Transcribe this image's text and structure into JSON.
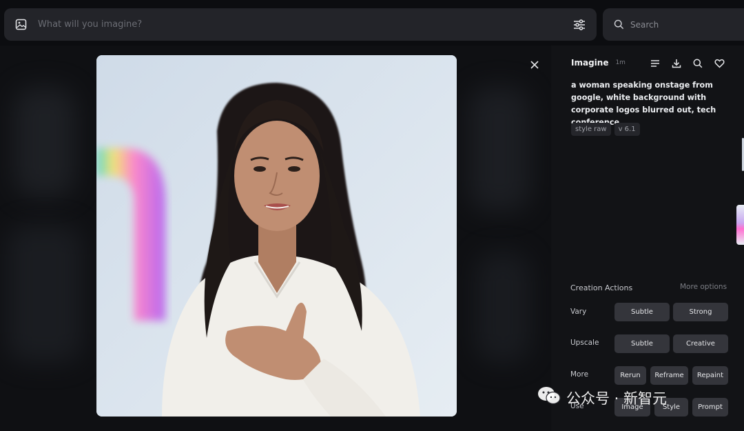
{
  "topbar": {
    "prompt_placeholder": "What will you imagine?",
    "search_placeholder": "Search"
  },
  "panel": {
    "title": "Imagine",
    "time": "1m",
    "prompt": "a woman speaking onstage from google, white background with corporate logos blurred out, tech conference",
    "tags": [
      "style raw",
      "v 6.1"
    ],
    "actions_title": "Creation Actions",
    "more_options": "More options",
    "rows": [
      {
        "label": "Vary",
        "buttons": [
          "Subtle",
          "Strong"
        ]
      },
      {
        "label": "Upscale",
        "buttons": [
          "Subtle",
          "Creative"
        ]
      },
      {
        "label": "More",
        "buttons": [
          "Rerun",
          "Reframe",
          "Repaint"
        ]
      },
      {
        "label": "Use",
        "buttons": [
          "Image",
          "Style",
          "Prompt"
        ]
      }
    ]
  },
  "watermark": "公众号 · 新智元",
  "icons": [
    "image-icon",
    "sliders-icon",
    "search-icon",
    "close-icon",
    "list-icon",
    "download-icon",
    "search-icon",
    "heart-icon",
    "wechat-icon"
  ]
}
